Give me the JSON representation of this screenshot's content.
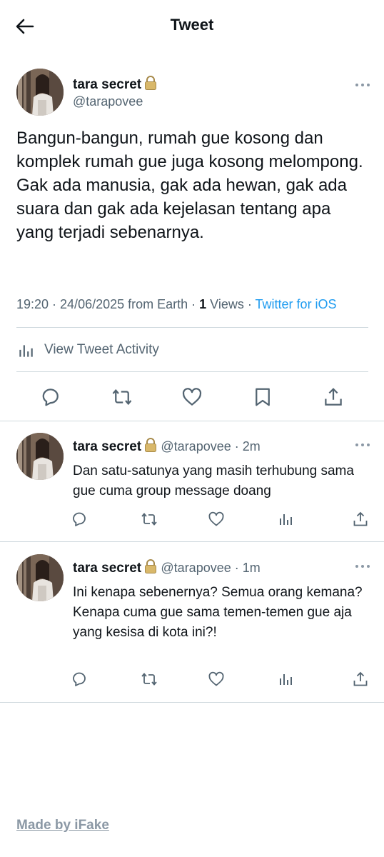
{
  "header": {
    "title": "Tweet",
    "back_icon": "arrow-left-icon"
  },
  "main_tweet": {
    "name": "tara secret",
    "handle": "@tarapovee",
    "text": "Bangun-bangun, rumah gue kosong dan komplek rumah gue juga kosong melompong. Gak ada manusia, gak ada hewan, gak ada suara dan gak ada kejelasan tentang apa yang terjadi sebenarnya.",
    "time": "19:20 · 24/06/2025 from Earth · ",
    "views_count": "1",
    "views_label": " Views · ",
    "client": "Twitter for iOS",
    "activity_label": "View Tweet Activity"
  },
  "replies": [
    {
      "name": "tara secret",
      "handle_time": "@tarapovee · 2m",
      "text": "Dan satu-satunya yang masih terhubung sama gue cuma group message doang"
    },
    {
      "name": "tara secret",
      "handle_time": "@tarapovee · 1m",
      "text": "Ini kenapa sebenernya? Semua orang kemana? Kenapa cuma gue sama temen-temen gue aja yang kesisa di kota ini?!"
    }
  ],
  "footer": {
    "label": "Made by iFake"
  },
  "colors": {
    "text": "#0f1419",
    "secondary": "#536471",
    "accent": "#1d9bf0",
    "divider": "#cfd9de"
  }
}
